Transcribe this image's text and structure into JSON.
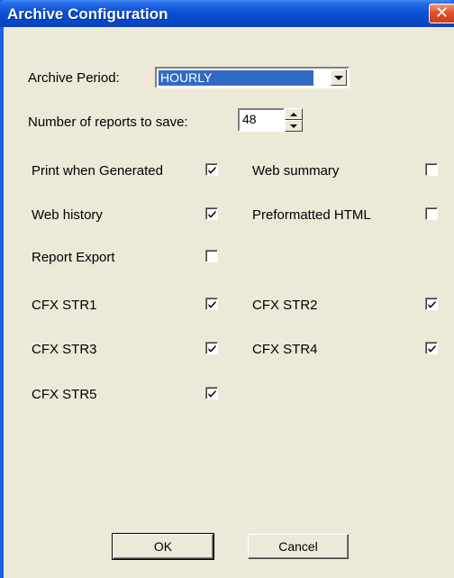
{
  "window": {
    "title": "Archive Configuration"
  },
  "archive_period": {
    "label": "Archive Period:",
    "value": "HOURLY"
  },
  "reports_to_save": {
    "label": "Number of reports to save:",
    "value": "48"
  },
  "options": {
    "print_when_generated": {
      "label": "Print when Generated",
      "checked": true
    },
    "web_summary": {
      "label": "Web summary",
      "checked": false
    },
    "web_history": {
      "label": "Web history",
      "checked": true
    },
    "preformatted_html": {
      "label": "Preformatted HTML",
      "checked": false
    },
    "report_export": {
      "label": "Report Export",
      "checked": false
    },
    "cfx_str1": {
      "label": "CFX STR1",
      "checked": true
    },
    "cfx_str2": {
      "label": "CFX STR2",
      "checked": true
    },
    "cfx_str3": {
      "label": "CFX STR3",
      "checked": true
    },
    "cfx_str4": {
      "label": "CFX STR4",
      "checked": true
    },
    "cfx_str5": {
      "label": "CFX STR5",
      "checked": true
    }
  },
  "buttons": {
    "ok": "OK",
    "cancel": "Cancel"
  }
}
